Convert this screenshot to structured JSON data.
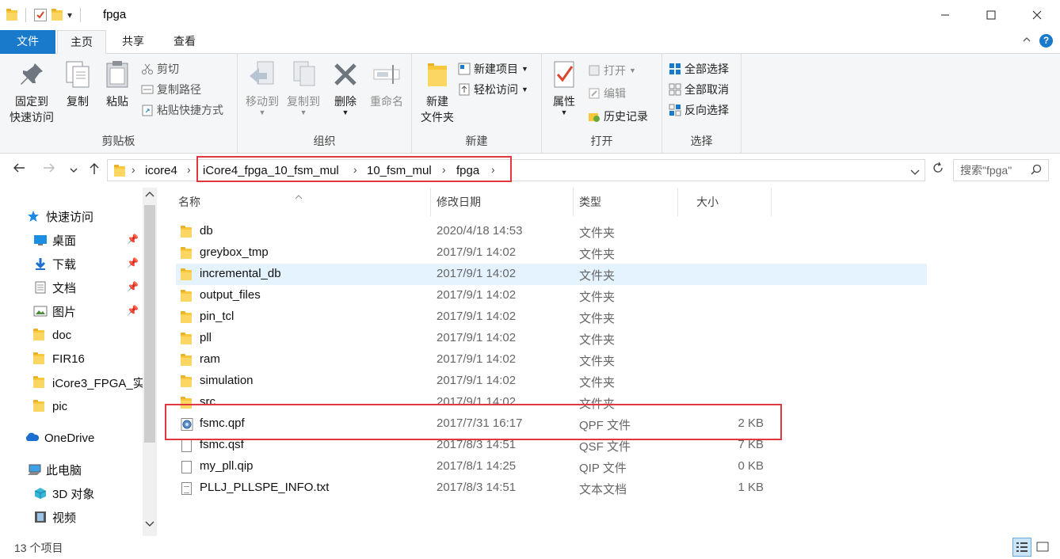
{
  "window": {
    "title": "fpga",
    "qat_dropdown": "▾"
  },
  "ribbon_tabs": {
    "file": "文件",
    "home": "主页",
    "share": "共享",
    "view": "查看"
  },
  "ribbon": {
    "clipboard": {
      "label": "剪贴板",
      "pin": "固定到\n快速访问",
      "pin_l1": "固定到",
      "pin_l2": "快速访问",
      "copy": "复制",
      "paste": "粘贴",
      "cut": "剪切",
      "copy_path": "复制路径",
      "paste_shortcut": "粘贴快捷方式"
    },
    "organize": {
      "label": "组织",
      "move_to": "移动到",
      "copy_to": "复制到",
      "delete": "删除",
      "rename": "重命名"
    },
    "new": {
      "label": "新建",
      "new_folder_l1": "新建",
      "new_folder_l2": "文件夹",
      "new_item": "新建项目",
      "easy_access": "轻松访问"
    },
    "open": {
      "label": "打开",
      "properties": "属性",
      "open": "打开",
      "edit": "编辑",
      "history": "历史记录"
    },
    "select": {
      "label": "选择",
      "select_all": "全部选择",
      "select_none": "全部取消",
      "invert": "反向选择"
    }
  },
  "address": {
    "crumbs": [
      "icore4",
      "iCore4_fpga_10_fsm_mul",
      "10_fsm_mul",
      "fpga"
    ],
    "search_placeholder": "搜索\"fpga\""
  },
  "nav_pane": {
    "quick_access": "快速访问",
    "items": [
      {
        "label": "桌面",
        "pinned": true
      },
      {
        "label": "下载",
        "pinned": true
      },
      {
        "label": "文档",
        "pinned": true
      },
      {
        "label": "图片",
        "pinned": true
      },
      {
        "label": "doc",
        "pinned": false
      },
      {
        "label": "FIR16",
        "pinned": false
      },
      {
        "label": "iCore3_FPGA_实",
        "pinned": false
      },
      {
        "label": "pic",
        "pinned": false
      }
    ],
    "onedrive": "OneDrive",
    "this_pc": "此电脑",
    "objects_3d": "3D 对象",
    "videos": "视频"
  },
  "columns": {
    "name": "名称",
    "date": "修改日期",
    "type": "类型",
    "size": "大小"
  },
  "files": [
    {
      "name": "db",
      "date": "2020/4/18 14:53",
      "type": "文件夹",
      "size": "",
      "kind": "folder"
    },
    {
      "name": "greybox_tmp",
      "date": "2017/9/1 14:02",
      "type": "文件夹",
      "size": "",
      "kind": "folder"
    },
    {
      "name": "incremental_db",
      "date": "2017/9/1 14:02",
      "type": "文件夹",
      "size": "",
      "kind": "folder"
    },
    {
      "name": "output_files",
      "date": "2017/9/1 14:02",
      "type": "文件夹",
      "size": "",
      "kind": "folder"
    },
    {
      "name": "pin_tcl",
      "date": "2017/9/1 14:02",
      "type": "文件夹",
      "size": "",
      "kind": "folder"
    },
    {
      "name": "pll",
      "date": "2017/9/1 14:02",
      "type": "文件夹",
      "size": "",
      "kind": "folder"
    },
    {
      "name": "ram",
      "date": "2017/9/1 14:02",
      "type": "文件夹",
      "size": "",
      "kind": "folder"
    },
    {
      "name": "simulation",
      "date": "2017/9/1 14:02",
      "type": "文件夹",
      "size": "",
      "kind": "folder"
    },
    {
      "name": "src",
      "date": "2017/9/1 14:02",
      "type": "文件夹",
      "size": "",
      "kind": "folder"
    },
    {
      "name": "fsmc.qpf",
      "date": "2017/7/31 16:17",
      "type": "QPF 文件",
      "size": "2 KB",
      "kind": "qpf"
    },
    {
      "name": "fsmc.qsf",
      "date": "2017/8/3 14:51",
      "type": "QSF 文件",
      "size": "7 KB",
      "kind": "file"
    },
    {
      "name": "my_pll.qip",
      "date": "2017/8/1 14:25",
      "type": "QIP 文件",
      "size": "0 KB",
      "kind": "file"
    },
    {
      "name": "PLLJ_PLLSPE_INFO.txt",
      "date": "2017/8/3 14:51",
      "type": "文本文档",
      "size": "1 KB",
      "kind": "txt"
    }
  ],
  "status": {
    "count": "13 个项目"
  },
  "colors": {
    "accent": "#1979ca",
    "highlight_box": "#e0383f",
    "selection": "#e5f3ff",
    "folder": "#f8c83a"
  }
}
